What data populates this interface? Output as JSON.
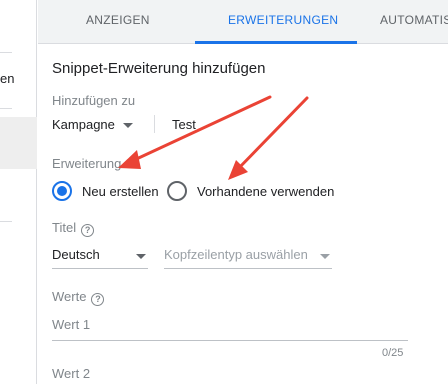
{
  "left_nav": {
    "label_fragment": "en"
  },
  "tabs": [
    {
      "label": "ANZEIGEN",
      "active": false
    },
    {
      "label": "ERWEITERUNGEN",
      "active": true
    },
    {
      "label": "AUTOMATIS",
      "active": false
    }
  ],
  "form": {
    "title": "Snippet-Erweiterung hinzufügen",
    "add_to": {
      "label": "Hinzufügen zu",
      "level": "Kampagne",
      "target": "Test"
    },
    "extension": {
      "label": "Erweiterung",
      "options": [
        {
          "label": "Neu erstellen",
          "selected": true
        },
        {
          "label": "Vorhandene verwenden",
          "selected": false
        }
      ]
    },
    "title_section": {
      "label": "Titel",
      "language": "Deutsch",
      "header_type_placeholder": "Kopfzeilentyp auswählen"
    },
    "values_section": {
      "label": "Werte",
      "fields": [
        {
          "placeholder": "Wert 1",
          "counter": "0/25"
        },
        {
          "placeholder": "Wert 2"
        }
      ]
    }
  },
  "colors": {
    "accent": "#1a73e8",
    "annotation_arrow": "#ea4335"
  }
}
